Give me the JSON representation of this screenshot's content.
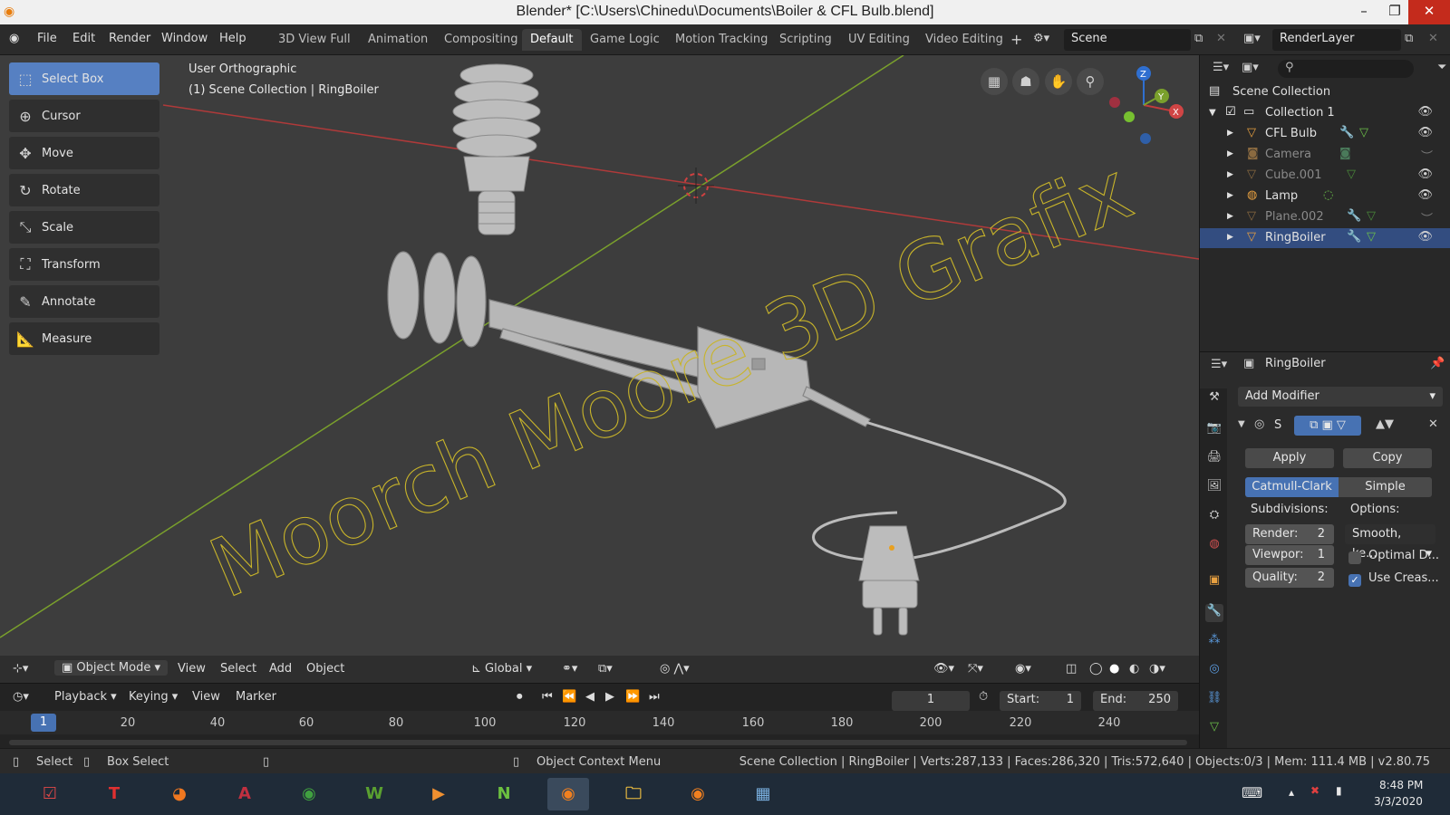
{
  "window": {
    "title": "Blender* [C:\\Users\\Chinedu\\Documents\\Boiler & CFL Bulb.blend]",
    "minimize": "–",
    "maximize": "❐",
    "close": "✕"
  },
  "menubar": {
    "items": [
      "File",
      "Edit",
      "Render",
      "Window",
      "Help"
    ]
  },
  "workspaces": {
    "tabs": [
      "3D View Full",
      "Animation",
      "Compositing",
      "Default",
      "Game Logic",
      "Motion Tracking",
      "Scripting",
      "UV Editing",
      "Video Editing"
    ],
    "active": "Default",
    "add": "+"
  },
  "scene": {
    "scene_name": "Scene",
    "render_layer": "RenderLayer"
  },
  "viewport": {
    "view_name": "User Orthographic",
    "collection_info": "(1) Scene Collection | RingBoiler",
    "watermark": "Moorch Moore 3D Grafix",
    "tools": [
      "Select Box",
      "Cursor",
      "Move",
      "Rotate",
      "Scale",
      "Transform",
      "Annotate",
      "Measure"
    ],
    "active_tool": "Select Box",
    "gizmo": {
      "x": "X",
      "y": "Y",
      "z": "Z"
    }
  },
  "viewport_header": {
    "mode": "Object Mode",
    "menus": [
      "View",
      "Select",
      "Add",
      "Object"
    ],
    "orientation": "Global"
  },
  "timeline": {
    "menus": [
      "Playback",
      "Keying",
      "View",
      "Marker"
    ],
    "current_frame": "1",
    "start_label": "Start:",
    "start": "1",
    "end_label": "End:",
    "end": "250",
    "ticks": [
      "20",
      "40",
      "60",
      "80",
      "100",
      "120",
      "140",
      "160",
      "180",
      "200",
      "220",
      "240"
    ],
    "playhead": "1"
  },
  "outliner": {
    "root": "Scene Collection",
    "collection": "Collection 1",
    "objects": [
      {
        "name": "CFL Bulb",
        "dim": false,
        "visible": true
      },
      {
        "name": "Camera",
        "dim": true,
        "visible": false
      },
      {
        "name": "Cube.001",
        "dim": true,
        "visible": true
      },
      {
        "name": "Lamp",
        "dim": false,
        "visible": true
      },
      {
        "name": "Plane.002",
        "dim": true,
        "visible": false
      },
      {
        "name": "RingBoiler",
        "dim": false,
        "visible": true,
        "selected": true
      }
    ]
  },
  "properties": {
    "object_name": "RingBoiler",
    "add_modifier": "Add Modifier",
    "modifier_short": "S",
    "apply": "Apply",
    "copy": "Copy",
    "catmull": "Catmull-Clark",
    "simple": "Simple",
    "subdivisions_label": "Subdivisions:",
    "options_label": "Options:",
    "render_field": "Render:",
    "render_value": "2",
    "viewport_field": "Viewpor:",
    "viewport_value": "1",
    "quality_field": "Quality:",
    "quality_value": "2",
    "smooth": "Smooth, ke...",
    "optimal": "Optimal D...",
    "use_crease": "Use Creas..."
  },
  "statusbar": {
    "select": "Select",
    "box_select": "Box Select",
    "context_menu": "Object Context Menu",
    "stats": "Scene Collection | RingBoiler | Verts:287,133 | Faces:286,320 | Tris:572,640 | Objects:0/3 | Mem: 111.4 MB | v2.80.75"
  },
  "taskbar": {
    "time": "8:48 PM",
    "date": "3/3/2020"
  },
  "colors": {
    "accent": "#5680c2",
    "selected_row": "#334d80",
    "axis_x": "#c23b3b",
    "axis_y": "#7aa02c",
    "watermark": "#c8b42a"
  }
}
